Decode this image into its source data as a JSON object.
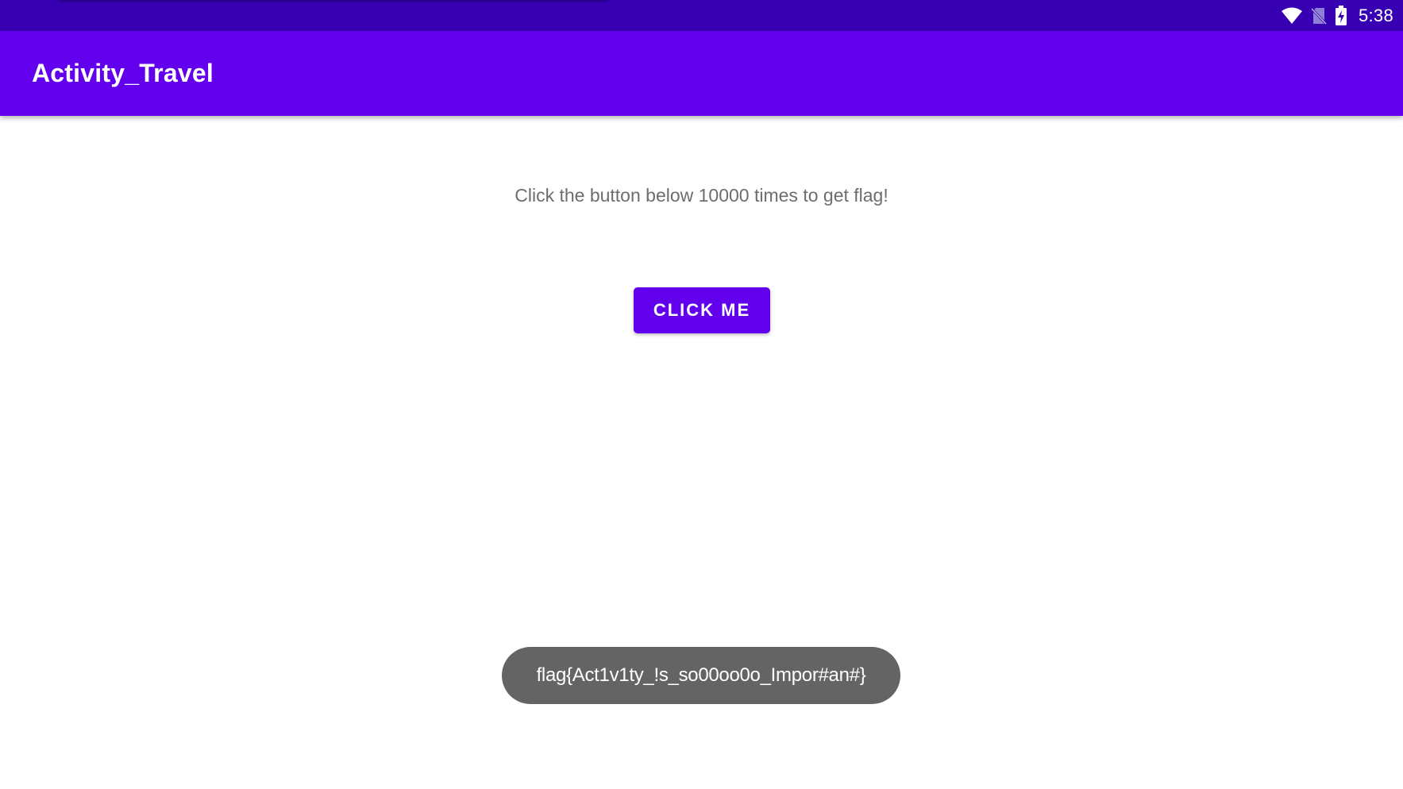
{
  "status_bar": {
    "time": "5:38",
    "icons": [
      "wifi-icon",
      "no-sim-icon",
      "battery-charging-icon"
    ],
    "color": "#3700b3"
  },
  "app_bar": {
    "title": "Activity_Travel",
    "color": "#6200ee"
  },
  "main": {
    "instruction": "Click the button below 10000 times to get flag!",
    "button_label": "CLICK ME"
  },
  "toast": {
    "message": "flag{Act1v1ty_!s_so00oo0o_Impor#an#}"
  }
}
